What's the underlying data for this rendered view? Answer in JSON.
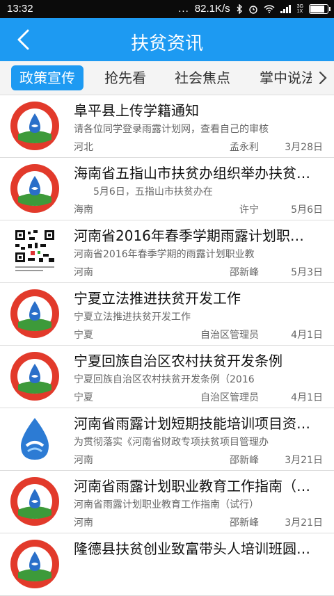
{
  "status_bar": {
    "time": "13:32",
    "dots": "...",
    "speed": "82.1K/s",
    "network_label_top": "3G",
    "network_label_bottom": "1X"
  },
  "header": {
    "title": "扶贫资讯",
    "color": "#1d9af2"
  },
  "tabs": [
    {
      "label": "政策宣传",
      "active": true
    },
    {
      "label": "抢先看",
      "active": false
    },
    {
      "label": "社会焦点",
      "active": false
    },
    {
      "label": "掌中说法",
      "active": false
    }
  ],
  "articles": [
    {
      "title": "阜平县上传学籍通知",
      "summary": "请各位同学登录雨露计划网，查看自己的审核",
      "region": "河北",
      "author": "孟永利",
      "date": "3月28日",
      "thumb": "yulu-badge-icon"
    },
    {
      "title": "海南省五指山市扶贫办组织举办扶贫…",
      "summary": "　　5月6日，五指山市扶贫办在",
      "region": "海南",
      "author": "许宁",
      "date": "5月6日",
      "thumb": "yulu-badge-icon"
    },
    {
      "title": "河南省2016年春季学期雨露计划职…",
      "summary": "河南省2016年春季学期的雨露计划职业教",
      "region": "河南",
      "author": "邵新峰",
      "date": "5月3日",
      "thumb": "qr-code-icon"
    },
    {
      "title": "宁夏立法推进扶贫开发工作",
      "summary": "宁夏立法推进扶贫开发工作",
      "region": "宁夏",
      "author": "自治区管理员",
      "date": "4月1日",
      "thumb": "yulu-badge-icon"
    },
    {
      "title": "宁夏回族自治区农村扶贫开发条例",
      "summary": "宁夏回族自治区农村扶贫开发条例（2016",
      "region": "宁夏",
      "author": "自治区管理员",
      "date": "4月1日",
      "thumb": "yulu-badge-icon"
    },
    {
      "title": "河南省雨露计划短期技能培训项目资…",
      "summary": "为贯彻落实《河南省财政专项扶贫项目管理办",
      "region": "河南",
      "author": "邵新峰",
      "date": "3月21日",
      "thumb": "water-drop-logo-icon"
    },
    {
      "title": "河南省雨露计划职业教育工作指南（…",
      "summary": "河南省雨露计划职业教育工作指南（试行）",
      "region": "河南",
      "author": "邵新峰",
      "date": "3月21日",
      "thumb": "yulu-badge-icon"
    },
    {
      "title": "隆德县扶贫创业致富带头人培训班圆…",
      "summary": "",
      "region": "",
      "author": "",
      "date": "",
      "thumb": "yulu-badge-icon"
    }
  ]
}
